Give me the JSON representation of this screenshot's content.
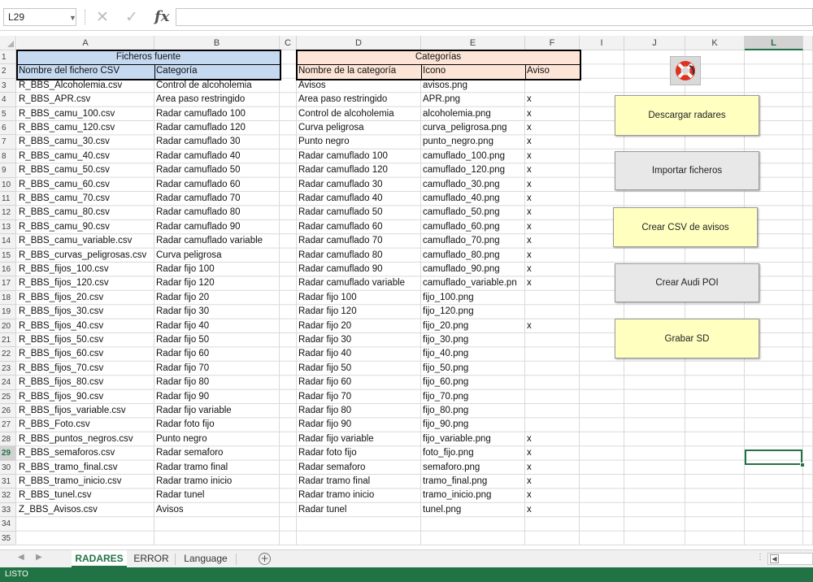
{
  "formula_bar": {
    "name_box": "L29",
    "fx_label": "fx",
    "formula_value": ""
  },
  "columns": [
    "A",
    "B",
    "C",
    "D",
    "E",
    "F",
    "I",
    "J",
    "K",
    "L"
  ],
  "selected_column": "L",
  "selected_row": 29,
  "rows": [
    {
      "n": 1,
      "cells": {
        "AB": "Ficheros fuente",
        "DF": "Categorías"
      }
    },
    {
      "n": 2,
      "cells": {
        "A": "Nombre del fichero CSV",
        "B": "Categoría",
        "D": "Nombre de la categoría",
        "E": "Icono",
        "F": "Aviso"
      }
    },
    {
      "n": 3,
      "cells": {
        "A": "R_BBS_Alcoholemia.csv",
        "B": "Control de alcoholemia",
        "D": "Avisos",
        "E": "avisos.png",
        "F": ""
      }
    },
    {
      "n": 4,
      "cells": {
        "A": "R_BBS_APR.csv",
        "B": "Area paso restringido",
        "D": "Area paso restringido",
        "E": "APR.png",
        "F": "x"
      }
    },
    {
      "n": 5,
      "cells": {
        "A": "R_BBS_camu_100.csv",
        "B": "Radar camuflado 100",
        "D": "Control de alcoholemia",
        "E": "alcoholemia.png",
        "F": "x"
      }
    },
    {
      "n": 6,
      "cells": {
        "A": "R_BBS_camu_120.csv",
        "B": "Radar camuflado 120",
        "D": "Curva peligrosa",
        "E": "curva_peligrosa.png",
        "F": "x"
      }
    },
    {
      "n": 7,
      "cells": {
        "A": "R_BBS_camu_30.csv",
        "B": "Radar camuflado 30",
        "D": "Punto negro",
        "E": "punto_negro.png",
        "F": "x"
      }
    },
    {
      "n": 8,
      "cells": {
        "A": "R_BBS_camu_40.csv",
        "B": "Radar camuflado 40",
        "D": "Radar camuflado 100",
        "E": "camuflado_100.png",
        "F": "x"
      }
    },
    {
      "n": 9,
      "cells": {
        "A": "R_BBS_camu_50.csv",
        "B": "Radar camuflado 50",
        "D": "Radar camuflado 120",
        "E": "camuflado_120.png",
        "F": "x"
      }
    },
    {
      "n": 10,
      "cells": {
        "A": "R_BBS_camu_60.csv",
        "B": "Radar camuflado 60",
        "D": "Radar camuflado 30",
        "E": "camuflado_30.png",
        "F": "x"
      }
    },
    {
      "n": 11,
      "cells": {
        "A": "R_BBS_camu_70.csv",
        "B": "Radar camuflado 70",
        "D": "Radar camuflado 40",
        "E": "camuflado_40.png",
        "F": "x"
      }
    },
    {
      "n": 12,
      "cells": {
        "A": "R_BBS_camu_80.csv",
        "B": "Radar camuflado 80",
        "D": "Radar camuflado 50",
        "E": "camuflado_50.png",
        "F": "x"
      }
    },
    {
      "n": 13,
      "cells": {
        "A": "R_BBS_camu_90.csv",
        "B": "Radar camuflado 90",
        "D": "Radar camuflado 60",
        "E": "camuflado_60.png",
        "F": "x"
      }
    },
    {
      "n": 14,
      "cells": {
        "A": "R_BBS_camu_variable.csv",
        "B": "Radar camuflado variable",
        "D": "Radar camuflado 70",
        "E": "camuflado_70.png",
        "F": "x"
      }
    },
    {
      "n": 15,
      "cells": {
        "A": "R_BBS_curvas_peligrosas.csv",
        "B": "Curva peligrosa",
        "D": "Radar camuflado 80",
        "E": "camuflado_80.png",
        "F": "x"
      }
    },
    {
      "n": 16,
      "cells": {
        "A": "R_BBS_fijos_100.csv",
        "B": "Radar fijo 100",
        "D": "Radar camuflado 90",
        "E": "camuflado_90.png",
        "F": "x"
      }
    },
    {
      "n": 17,
      "cells": {
        "A": "R_BBS_fijos_120.csv",
        "B": "Radar fijo 120",
        "D": "Radar camuflado variable",
        "E": "camuflado_variable.pn",
        "F": "x"
      }
    },
    {
      "n": 18,
      "cells": {
        "A": "R_BBS_fijos_20.csv",
        "B": "Radar fijo 20",
        "D": "Radar fijo 100",
        "E": "fijo_100.png",
        "F": ""
      }
    },
    {
      "n": 19,
      "cells": {
        "A": "R_BBS_fijos_30.csv",
        "B": "Radar fijo 30",
        "D": "Radar fijo 120",
        "E": "fijo_120.png",
        "F": ""
      }
    },
    {
      "n": 20,
      "cells": {
        "A": "R_BBS_fijos_40.csv",
        "B": "Radar fijo 40",
        "D": "Radar fijo 20",
        "E": "fijo_20.png",
        "F": "x"
      }
    },
    {
      "n": 21,
      "cells": {
        "A": "R_BBS_fijos_50.csv",
        "B": "Radar fijo 50",
        "D": "Radar fijo 30",
        "E": "fijo_30.png",
        "F": ""
      }
    },
    {
      "n": 22,
      "cells": {
        "A": "R_BBS_fijos_60.csv",
        "B": "Radar fijo 60",
        "D": "Radar fijo 40",
        "E": "fijo_40.png",
        "F": ""
      }
    },
    {
      "n": 23,
      "cells": {
        "A": "R_BBS_fijos_70.csv",
        "B": "Radar fijo 70",
        "D": "Radar fijo 50",
        "E": "fijo_50.png",
        "F": ""
      }
    },
    {
      "n": 24,
      "cells": {
        "A": "R_BBS_fijos_80.csv",
        "B": "Radar fijo 80",
        "D": "Radar fijo 60",
        "E": "fijo_60.png",
        "F": ""
      }
    },
    {
      "n": 25,
      "cells": {
        "A": "R_BBS_fijos_90.csv",
        "B": "Radar fijo 90",
        "D": "Radar fijo 70",
        "E": "fijo_70.png",
        "F": ""
      }
    },
    {
      "n": 26,
      "cells": {
        "A": "R_BBS_fijos_variable.csv",
        "B": "Radar fijo variable",
        "D": "Radar fijo 80",
        "E": "fijo_80.png",
        "F": ""
      }
    },
    {
      "n": 27,
      "cells": {
        "A": "R_BBS_Foto.csv",
        "B": "Radar foto fijo",
        "D": "Radar fijo 90",
        "E": "fijo_90.png",
        "F": ""
      }
    },
    {
      "n": 28,
      "cells": {
        "A": "R_BBS_puntos_negros.csv",
        "B": "Punto negro",
        "D": "Radar fijo variable",
        "E": "fijo_variable.png",
        "F": "x"
      }
    },
    {
      "n": 29,
      "cells": {
        "A": "R_BBS_semaforos.csv",
        "B": "Radar semaforo",
        "D": "Radar foto fijo",
        "E": "foto_fijo.png",
        "F": "x"
      }
    },
    {
      "n": 30,
      "cells": {
        "A": "R_BBS_tramo_final.csv",
        "B": "Radar tramo final",
        "D": "Radar semaforo",
        "E": "semaforo.png",
        "F": "x"
      }
    },
    {
      "n": 31,
      "cells": {
        "A": "R_BBS_tramo_inicio.csv",
        "B": "Radar tramo inicio",
        "D": "Radar tramo final",
        "E": "tramo_final.png",
        "F": "x"
      }
    },
    {
      "n": 32,
      "cells": {
        "A": "R_BBS_tunel.csv",
        "B": "Radar tunel",
        "D": "Radar tramo inicio",
        "E": "tramo_inicio.png",
        "F": "x"
      }
    },
    {
      "n": 33,
      "cells": {
        "A": "Z_BBS_Avisos.csv",
        "B": "Avisos",
        "D": "Radar tunel",
        "E": "tunel.png",
        "F": "x"
      }
    },
    {
      "n": 34,
      "cells": {}
    },
    {
      "n": 35,
      "cells": {}
    }
  ],
  "buttons": [
    {
      "id": "descargar-radares-button",
      "label": "Descargar radares",
      "style": "yellow"
    },
    {
      "id": "importar-ficheros-button",
      "label": "Importar ficheros",
      "style": "gray"
    },
    {
      "id": "crear-csv-avisos-button",
      "label": "Crear CSV de avisos",
      "style": "yellow"
    },
    {
      "id": "crear-audi-poi-button",
      "label": "Crear Audi POI",
      "style": "gray"
    },
    {
      "id": "grabar-sd-button",
      "label": "Grabar SD",
      "style": "yellow"
    }
  ],
  "sheet_tabs": [
    {
      "label": "RADARES",
      "active": true
    },
    {
      "label": "ERROR",
      "active": false
    },
    {
      "label": "Language",
      "active": false
    }
  ],
  "status_text": "LISTO",
  "colors": {
    "header_blue": "#c5d9f1",
    "header_peach": "#fce4d6",
    "button_yellow": "#ffffc0",
    "button_gray": "#e8e8e8",
    "excel_green": "#217346"
  }
}
